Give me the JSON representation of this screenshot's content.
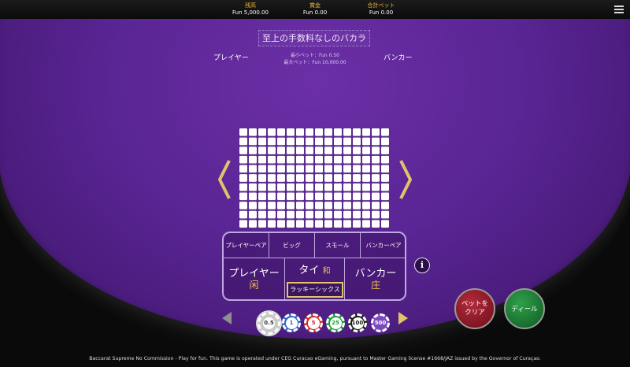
{
  "header": {
    "balance": {
      "label": "残高",
      "value": "Fun 5,000.00"
    },
    "win": {
      "label": "賞金",
      "value": "Fun 0.00"
    },
    "total_bet": {
      "label": "合計ベット",
      "value": "Fun 0.00"
    },
    "menu_icon": "hamburger-menu-icon"
  },
  "table": {
    "title": "至上の手数料なしのバカラ",
    "player_label": "プレイヤー",
    "banker_label": "バンカー",
    "min_bet": "最小ベット：Fun 0.50",
    "max_bet": "最大ベット：Fun 10,000.00",
    "roadmap": {
      "columns": 16,
      "rows": 11
    },
    "prev_icon": "chevron-left-icon",
    "next_icon": "chevron-right-icon"
  },
  "bets": {
    "player_pair": "プレイヤーペア",
    "big": "ビッグ",
    "small": "スモール",
    "banker_pair": "バンカーペア",
    "player": "プレイヤー",
    "player_hanzi": "闲",
    "tie": "タイ",
    "tie_hanzi": "和",
    "lucky_six": "ラッキーシックス",
    "banker": "バンカー",
    "banker_hanzi": "庄"
  },
  "info_icon": "i",
  "buttons": {
    "clear": "ベットを\nクリア",
    "deal": "ディール"
  },
  "chips": {
    "items": [
      {
        "value": "0.5",
        "color": "#c9c9c9",
        "selected": true
      },
      {
        "value": "1",
        "color": "#2a66c9",
        "selected": false
      },
      {
        "value": "5",
        "color": "#d22a2a",
        "selected": false
      },
      {
        "value": "25",
        "color": "#1d9a3a",
        "selected": false
      },
      {
        "value": "100",
        "color": "#1a1a1a",
        "selected": false
      },
      {
        "value": "500",
        "color": "#7b4bbd",
        "selected": false
      }
    ]
  },
  "footer": "Baccarat Supreme No Commission - Play for fun. This game is operated under CEG Curacao eGaming, pursuant to Master Gaming license #1668/JAZ issued by the Governor of Curaçao.",
  "colors": {
    "felt": "#5a2595",
    "accent_gold": "#f0b23a",
    "border": "#bfa9e0"
  }
}
